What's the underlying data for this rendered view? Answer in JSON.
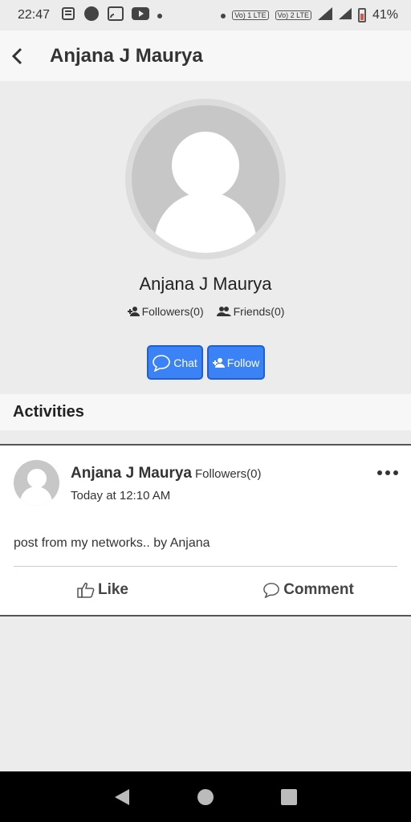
{
  "status_bar": {
    "time": "22:47",
    "battery": "41%",
    "volte1": "Vo) 1 LTE",
    "volte2": "Vo) 2 LTE"
  },
  "app_bar": {
    "title": "Anjana J Maurya"
  },
  "profile": {
    "name": "Anjana J Maurya",
    "followers": "Followers(0)",
    "friends": "Friends(0)",
    "chat_label": "Chat",
    "follow_label": "Follow"
  },
  "activities": {
    "header": "Activities"
  },
  "post": {
    "author": "Anjana J Maurya",
    "followers": "Followers(0)",
    "time": "Today at 12:10 AM",
    "text": "post from my networks.. by Anjana",
    "like_label": "Like",
    "comment_label": "Comment"
  },
  "colors": {
    "accent": "#3b82f6",
    "background": "#ececec",
    "nav": "#000000"
  }
}
